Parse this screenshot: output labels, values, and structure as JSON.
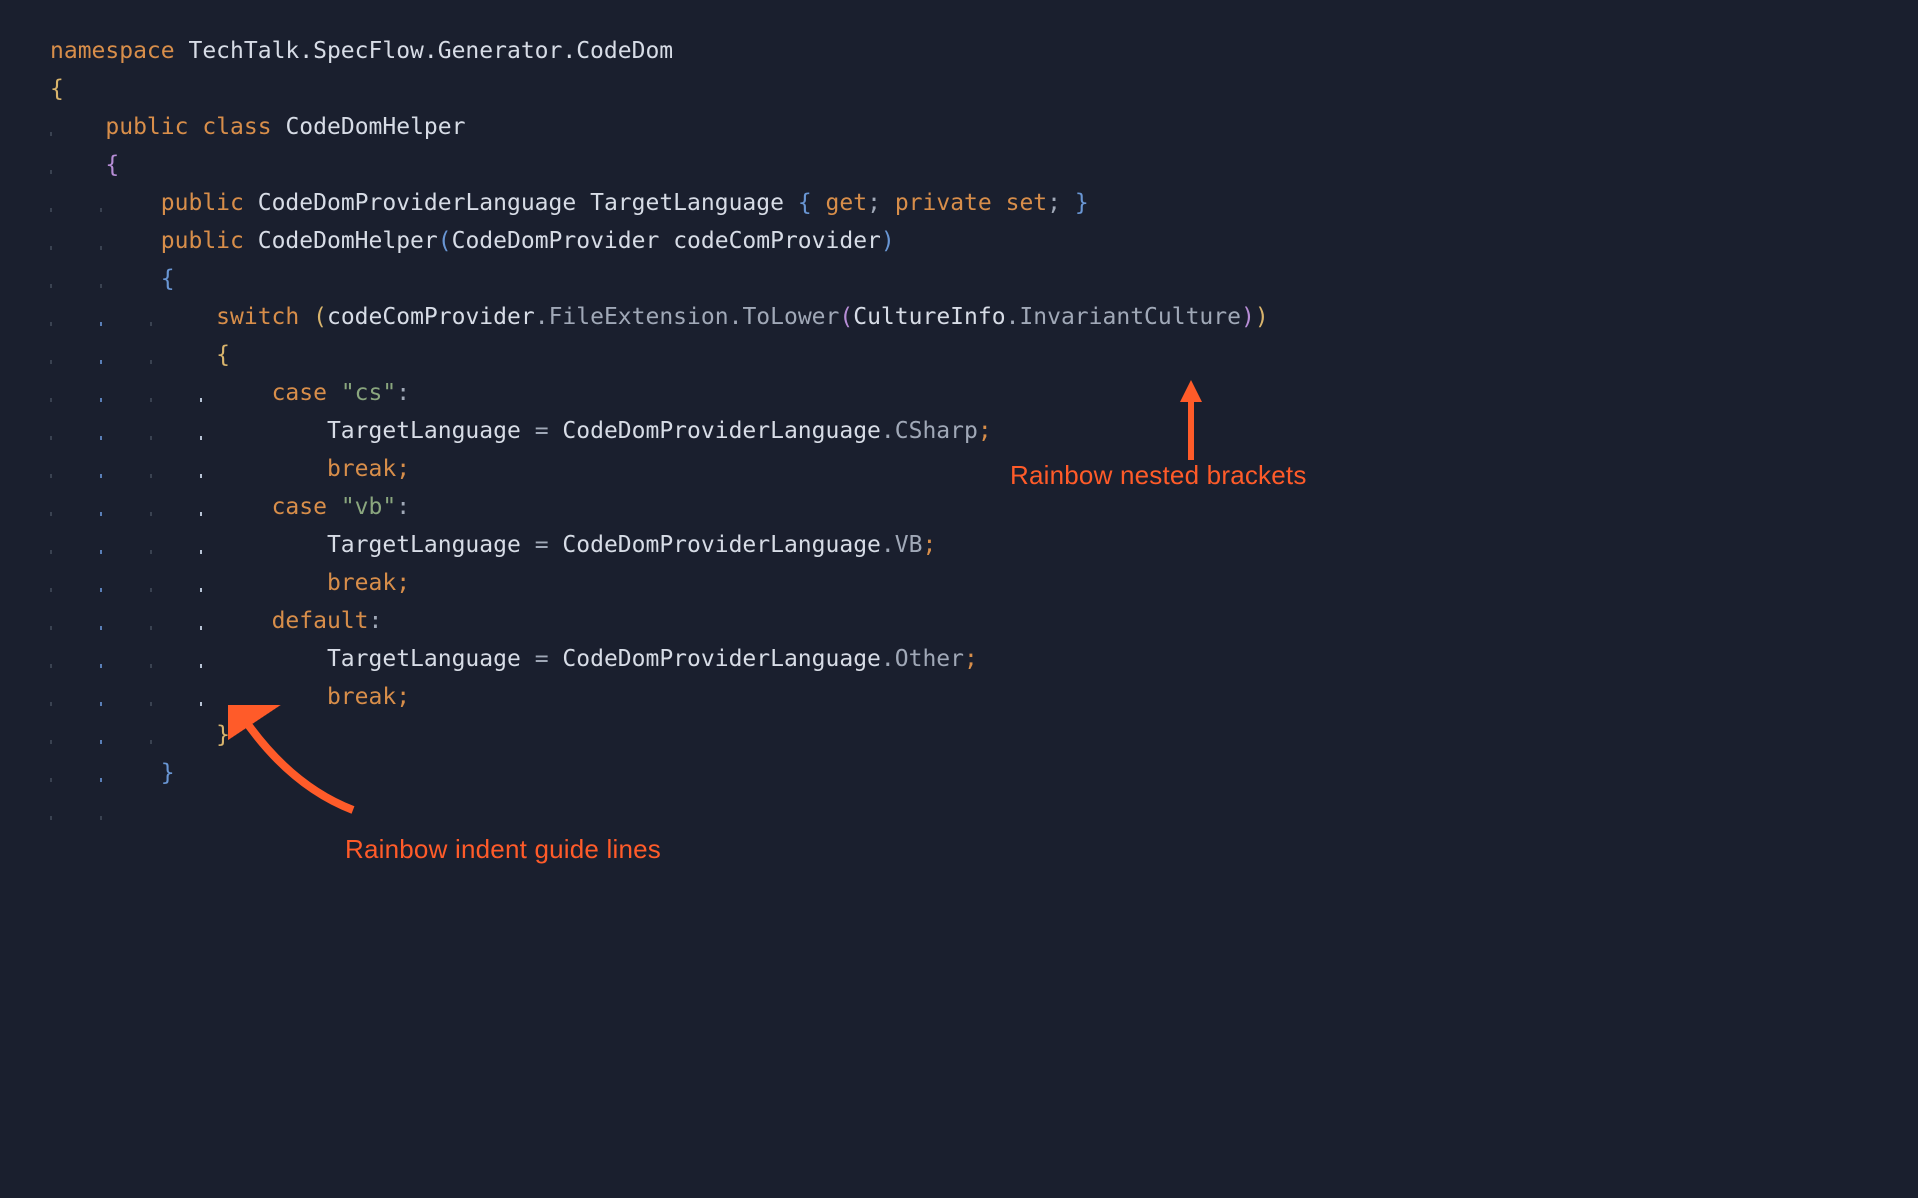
{
  "code": {
    "namespace_kw": "namespace",
    "namespace_name": "TechTalk.SpecFlow.Generator.CodeDom",
    "public_kw": "public",
    "class_kw": "class",
    "class_name": "CodeDomHelper",
    "prop_type": "CodeDomProviderLanguage",
    "prop_name": "TargetLanguage",
    "get_kw": "get",
    "private_kw": "private",
    "set_kw": "set",
    "ctor_name": "CodeDomHelper",
    "ctor_param_type": "CodeDomProvider",
    "ctor_param_name": "codeComProvider",
    "switch_kw": "switch",
    "switch_expr_obj": "codeComProvider",
    "switch_expr_prop": "FileExtension",
    "switch_expr_method": "ToLower",
    "culture_type": "CultureInfo",
    "culture_prop": "InvariantCulture",
    "case_kw": "case",
    "case1_val": "\"cs\"",
    "case2_val": "\"vb\"",
    "default_kw": "default",
    "assign_lhs": "TargetLanguage",
    "assign_enum": "CodeDomProviderLanguage",
    "case1_enum": "CSharp",
    "case2_enum": "VB",
    "default_enum": "Other",
    "break_kw": "break"
  },
  "annotations": {
    "rainbow_brackets": "Rainbow nested brackets",
    "rainbow_indent": "Rainbow indent guide lines"
  }
}
